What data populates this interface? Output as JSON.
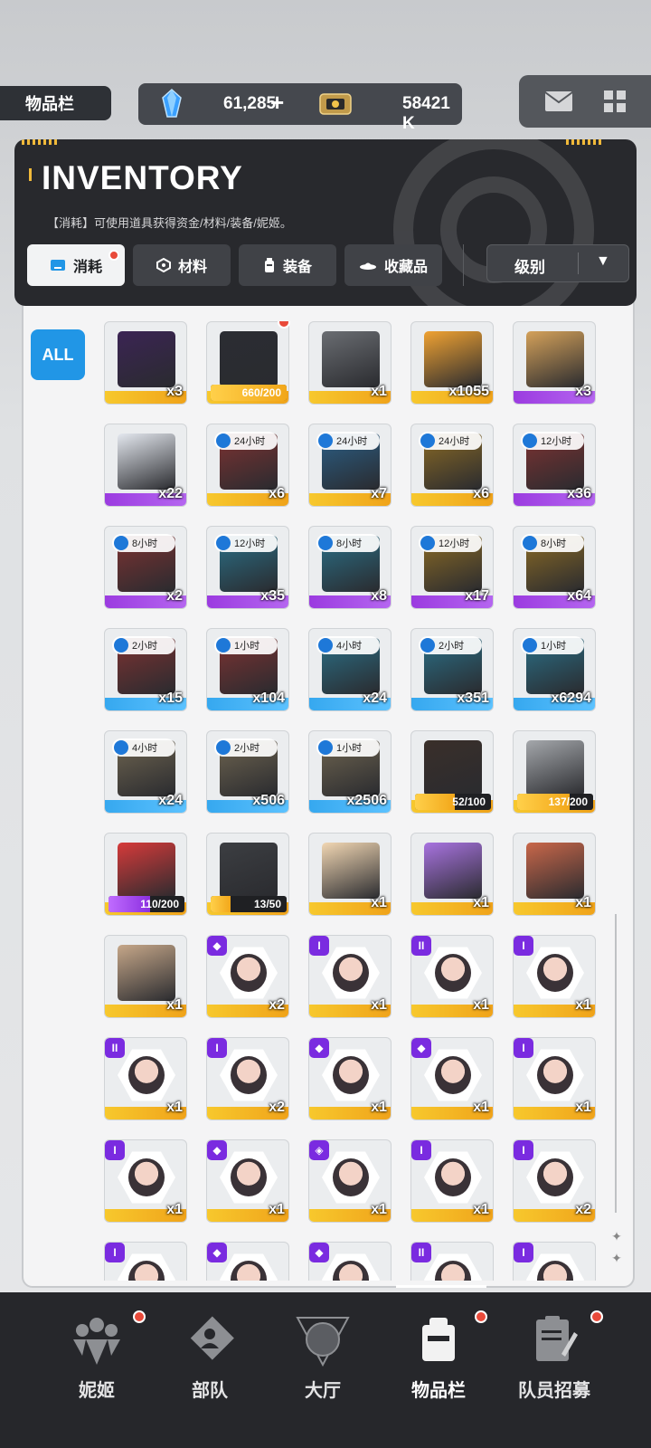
{
  "top_bar": {
    "page_label": "物品栏",
    "gem_value": "61,285",
    "plus": "+",
    "credit_value": "58421 K",
    "mail_icon": "mail-icon",
    "grid_icon": "grid-icon"
  },
  "header": {
    "title": "INVENTORY",
    "description": "【消耗】可使用道具获得资金/材料/装备/妮姬。"
  },
  "tabs": [
    {
      "label": "消耗",
      "icon": "consumable-icon",
      "active": true,
      "dot": true
    },
    {
      "label": "材料",
      "icon": "material-icon",
      "active": false
    },
    {
      "label": "装备",
      "icon": "equipment-icon",
      "active": false
    },
    {
      "label": "收藏品",
      "icon": "collection-icon",
      "active": false
    }
  ],
  "sort": {
    "label": "级别",
    "arrow": "▼"
  },
  "filter": {
    "all_label": "ALL"
  },
  "colors": {
    "gold": "#f7c82d",
    "purple": "#9b3be0",
    "blue": "#36a8ef",
    "accent": "#2196e6",
    "dot": "#e94a3a"
  },
  "items": [
    {
      "name": "purple-gift-box",
      "qty": "x3",
      "rarity": "gold",
      "art": "#3b2454"
    },
    {
      "name": "black-supply-box",
      "progress": "660/200",
      "fill": 1.0,
      "rarity": "gold",
      "art": "#2b2d33",
      "dot": true
    },
    {
      "name": "steel-crate-14",
      "qty": "x1",
      "rarity": "gold",
      "art": "#6a6d72"
    },
    {
      "name": "orange-supply-crate",
      "qty": "x1055",
      "rarity": "gold",
      "art": "#f0a232"
    },
    {
      "name": "cardboard-box",
      "qty": "x3",
      "rarity": "purple",
      "art": "#d4a15a"
    },
    {
      "name": "white-blue-crate",
      "qty": "x22",
      "rarity": "purple",
      "art": "#e4e8ef"
    },
    {
      "name": "red-case-24h",
      "timer": "24小时",
      "qty": "x6",
      "rarity": "gold",
      "art": "#7d3232"
    },
    {
      "name": "blue-case-24h",
      "timer": "24小时",
      "qty": "x7",
      "rarity": "gold",
      "art": "#2b5f86"
    },
    {
      "name": "gold-case-24h",
      "timer": "24小时",
      "qty": "x6",
      "rarity": "gold",
      "art": "#8a6a25"
    },
    {
      "name": "red-case-12h",
      "timer": "12小时",
      "qty": "x36",
      "rarity": "purple",
      "art": "#7d3232"
    },
    {
      "name": "red-case-8h",
      "timer": "8小时",
      "qty": "x2",
      "rarity": "purple",
      "art": "#7d3232"
    },
    {
      "name": "teal-case-12h",
      "timer": "12小时",
      "qty": "x35",
      "rarity": "purple",
      "art": "#2b6f86"
    },
    {
      "name": "teal-case-8h",
      "timer": "8小时",
      "qty": "x8",
      "rarity": "purple",
      "art": "#2b6f86"
    },
    {
      "name": "gold-case-12h",
      "timer": "12小时",
      "qty": "x17",
      "rarity": "purple",
      "art": "#8a6a25"
    },
    {
      "name": "gold-case-8h",
      "timer": "8小时",
      "qty": "x64",
      "rarity": "purple",
      "art": "#8a6a25"
    },
    {
      "name": "red-case-2h",
      "timer": "2小时",
      "qty": "x15",
      "rarity": "blue",
      "art": "#7d3232"
    },
    {
      "name": "red-case-1h",
      "timer": "1小时",
      "qty": "x104",
      "rarity": "blue",
      "art": "#7d3232"
    },
    {
      "name": "teal-case-4h",
      "timer": "4小时",
      "qty": "x24",
      "rarity": "blue",
      "art": "#2b6f86"
    },
    {
      "name": "teal-case-2h",
      "timer": "2小时",
      "qty": "x351",
      "rarity": "blue",
      "art": "#2b6f86"
    },
    {
      "name": "teal-case-1h",
      "timer": "1小时",
      "qty": "x6294",
      "rarity": "blue",
      "art": "#2b6f86"
    },
    {
      "name": "gold-case-4h",
      "timer": "4小时",
      "qty": "x24",
      "rarity": "blue",
      "art": "#6e6450"
    },
    {
      "name": "gold-case-2h",
      "timer": "2小时",
      "qty": "x506",
      "rarity": "blue",
      "art": "#6e6450"
    },
    {
      "name": "gold-case-1h",
      "timer": "1小时",
      "qty": "x2506",
      "rarity": "blue",
      "art": "#6e6450"
    },
    {
      "name": "black-orange-box",
      "progress": "52/100",
      "fill": 0.52,
      "rarity": "gold",
      "art": "#3a2f2a"
    },
    {
      "name": "silver-crate",
      "progress": "137/200",
      "fill": 0.685,
      "rarity": "gold",
      "art": "#a4a7ab"
    },
    {
      "name": "lucky-box",
      "progress": "110/200",
      "fill": 0.55,
      "fill_style": "purple",
      "rarity": "gold",
      "art": "#d63a3a"
    },
    {
      "name": "silver-gift-box",
      "progress": "13/50",
      "fill": 0.26,
      "rarity": "gold",
      "art": "#3c3e42"
    },
    {
      "name": "1000-cake",
      "qty": "x1",
      "rarity": "gold",
      "art": "#f2d7b3"
    },
    {
      "name": "purple-25th-cake",
      "qty": "x1",
      "rarity": "gold",
      "art": "#a873e0"
    },
    {
      "name": "red-cake",
      "qty": "x1",
      "rarity": "gold",
      "art": "#c9674a"
    },
    {
      "name": "15-cake",
      "qty": "x1",
      "rarity": "gold",
      "art": "#c6a789"
    },
    {
      "name": "character-card-1",
      "badge": "◆",
      "qty": "x2",
      "rarity": "gold",
      "hex": true
    },
    {
      "name": "character-card-2",
      "badge": "I",
      "qty": "x1",
      "rarity": "gold",
      "hex": true
    },
    {
      "name": "character-card-3",
      "badge": "II",
      "qty": "x1",
      "rarity": "gold",
      "hex": true
    },
    {
      "name": "character-card-4",
      "badge": "I",
      "qty": "x1",
      "rarity": "gold",
      "hex": true
    },
    {
      "name": "character-card-5",
      "badge": "II",
      "qty": "x1",
      "rarity": "gold",
      "hex": true
    },
    {
      "name": "character-card-6",
      "badge": "I",
      "qty": "x2",
      "rarity": "gold",
      "hex": true
    },
    {
      "name": "character-card-7",
      "badge": "◆",
      "qty": "x1",
      "rarity": "gold",
      "hex": true
    },
    {
      "name": "character-card-8",
      "badge": "◆",
      "qty": "x1",
      "rarity": "gold",
      "hex": true
    },
    {
      "name": "character-card-9",
      "badge": "I",
      "qty": "x1",
      "rarity": "gold",
      "hex": true
    },
    {
      "name": "character-card-10",
      "badge": "I",
      "qty": "x1",
      "rarity": "gold",
      "hex": true
    },
    {
      "name": "character-card-11",
      "badge": "◆",
      "qty": "x1",
      "rarity": "gold",
      "hex": true
    },
    {
      "name": "character-card-12",
      "badge": "◈",
      "qty": "x1",
      "rarity": "gold",
      "hex": true
    },
    {
      "name": "character-card-13",
      "badge": "I",
      "qty": "x1",
      "rarity": "gold",
      "hex": true
    },
    {
      "name": "character-card-14",
      "badge": "I",
      "qty": "x2",
      "rarity": "gold",
      "hex": true
    },
    {
      "name": "character-card-15",
      "badge": "I",
      "rarity": "gold",
      "hex": true
    },
    {
      "name": "character-card-16",
      "badge": "◆",
      "rarity": "gold",
      "hex": true
    },
    {
      "name": "character-card-17",
      "badge": "◆",
      "rarity": "gold",
      "hex": true
    },
    {
      "name": "character-card-18",
      "badge": "II",
      "rarity": "gold",
      "hex": true
    },
    {
      "name": "character-card-19",
      "badge": "I",
      "rarity": "gold",
      "hex": true
    }
  ],
  "nav": [
    {
      "label": "妮姬",
      "icon": "nikke-icon",
      "dot": true
    },
    {
      "label": "部队",
      "icon": "squad-icon"
    },
    {
      "label": "大厅",
      "icon": "lobby-icon"
    },
    {
      "label": "物品栏",
      "icon": "inventory-icon",
      "active": true,
      "dot": true
    },
    {
      "label": "队员招募",
      "icon": "recruit-icon",
      "dot": true
    }
  ]
}
